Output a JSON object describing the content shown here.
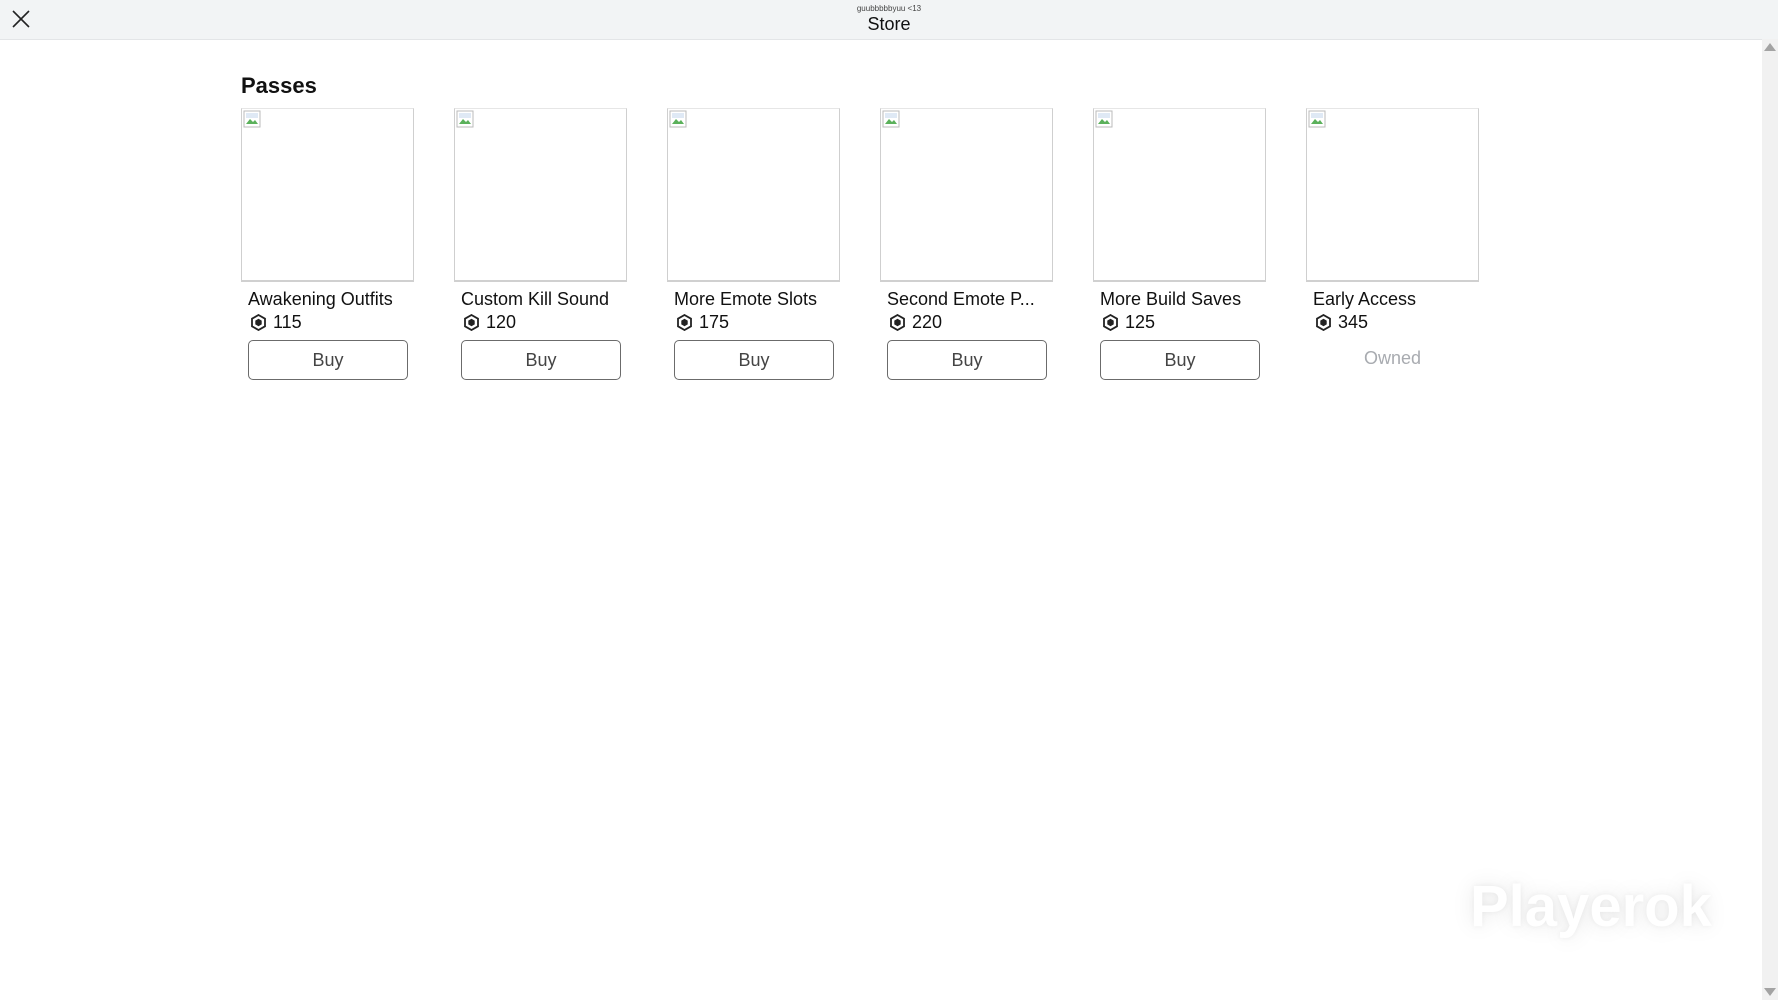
{
  "header": {
    "subtitle": "guubbbbbyuu <13",
    "title": "Store",
    "close_icon": "close-icon"
  },
  "section": {
    "title": "Passes"
  },
  "passes": [
    {
      "name": "Awakening Outfits",
      "price": "115",
      "action": "Buy",
      "owned": false
    },
    {
      "name": "Custom Kill Sound",
      "price": "120",
      "action": "Buy",
      "owned": false
    },
    {
      "name": "More Emote Slots",
      "price": "175",
      "action": "Buy",
      "owned": false
    },
    {
      "name": "Second Emote P...",
      "price": "220",
      "action": "Buy",
      "owned": false
    },
    {
      "name": "More Build Saves",
      "price": "125",
      "action": "Buy",
      "owned": false
    },
    {
      "name": "Early Access",
      "price": "345",
      "action": "Owned",
      "owned": true
    }
  ],
  "watermark": {
    "text": "Playerok"
  },
  "colors": {
    "topbar_bg": "#f2f4f5",
    "button_border": "#6b6b6b",
    "owned_text": "#a8abb0"
  }
}
